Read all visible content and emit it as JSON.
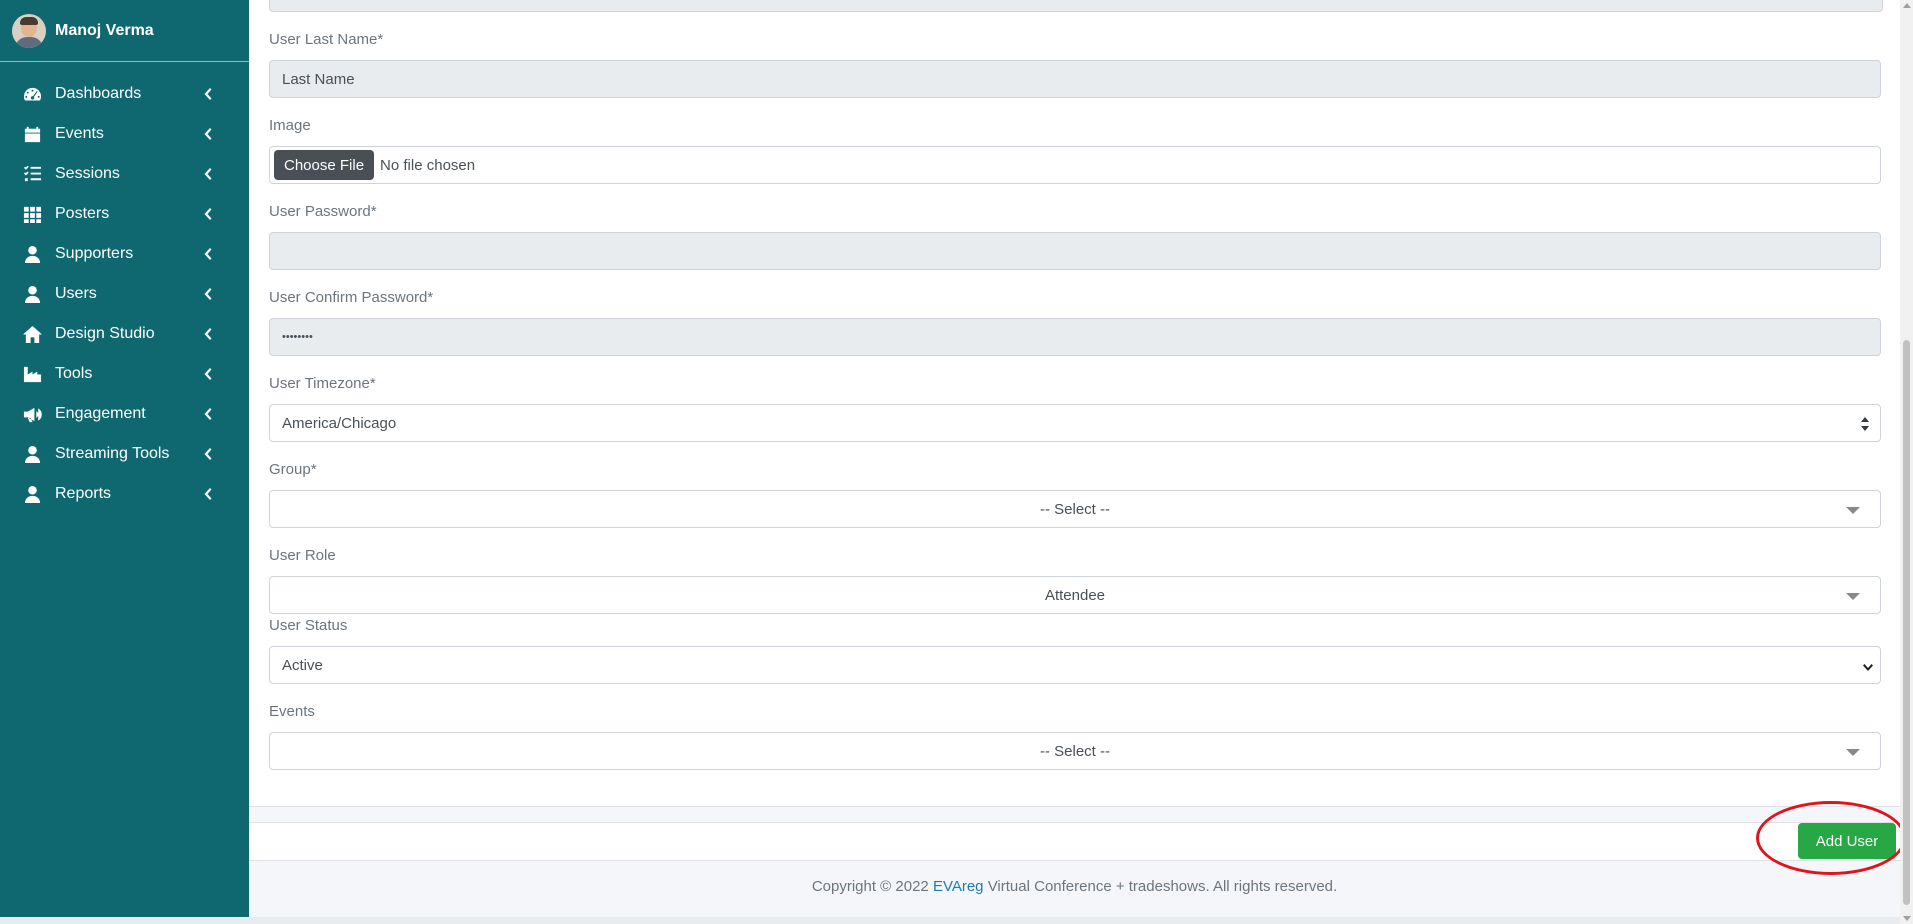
{
  "user": {
    "name": "Manoj Verma"
  },
  "sidebar": {
    "items": [
      {
        "label": "Dashboards",
        "icon": "tachometer-icon"
      },
      {
        "label": "Events",
        "icon": "calendar-icon"
      },
      {
        "label": "Sessions",
        "icon": "tasks-icon"
      },
      {
        "label": "Posters",
        "icon": "grid-icon"
      },
      {
        "label": "Supporters",
        "icon": "user-icon"
      },
      {
        "label": "Users",
        "icon": "user-icon"
      },
      {
        "label": "Design Studio",
        "icon": "home-icon"
      },
      {
        "label": "Tools",
        "icon": "industry-icon"
      },
      {
        "label": "Engagement",
        "icon": "bullhorn-icon"
      },
      {
        "label": "Streaming Tools",
        "icon": "user-icon"
      },
      {
        "label": "Reports",
        "icon": "user-icon"
      }
    ]
  },
  "form": {
    "last_name": {
      "label": "User Last Name*",
      "value": "Last Name"
    },
    "image": {
      "label": "Image",
      "button": "Choose File",
      "status": "No file chosen"
    },
    "password": {
      "label": "User Password*",
      "value": ""
    },
    "confirm_password": {
      "label": "User Confirm Password*",
      "value": "••••••••"
    },
    "timezone": {
      "label": "User Timezone*",
      "value": "America/Chicago"
    },
    "group": {
      "label": "Group*",
      "value": "-- Select --"
    },
    "role": {
      "label": "User Role",
      "value": "Attendee"
    },
    "status": {
      "label": "User Status",
      "value": "Active"
    },
    "events": {
      "label": "Events",
      "value": "-- Select --"
    }
  },
  "actions": {
    "add_user": "Add User"
  },
  "footer": {
    "prefix": "Copyright © 2022 ",
    "brand": "EVAreg",
    "suffix": " Virtual Conference + tradeshows. All rights reserved."
  },
  "colors": {
    "sidebar_bg": "#0f6870",
    "primary_button": "#28a745",
    "highlight": "#e0141e",
    "link": "#1f7bb8"
  }
}
